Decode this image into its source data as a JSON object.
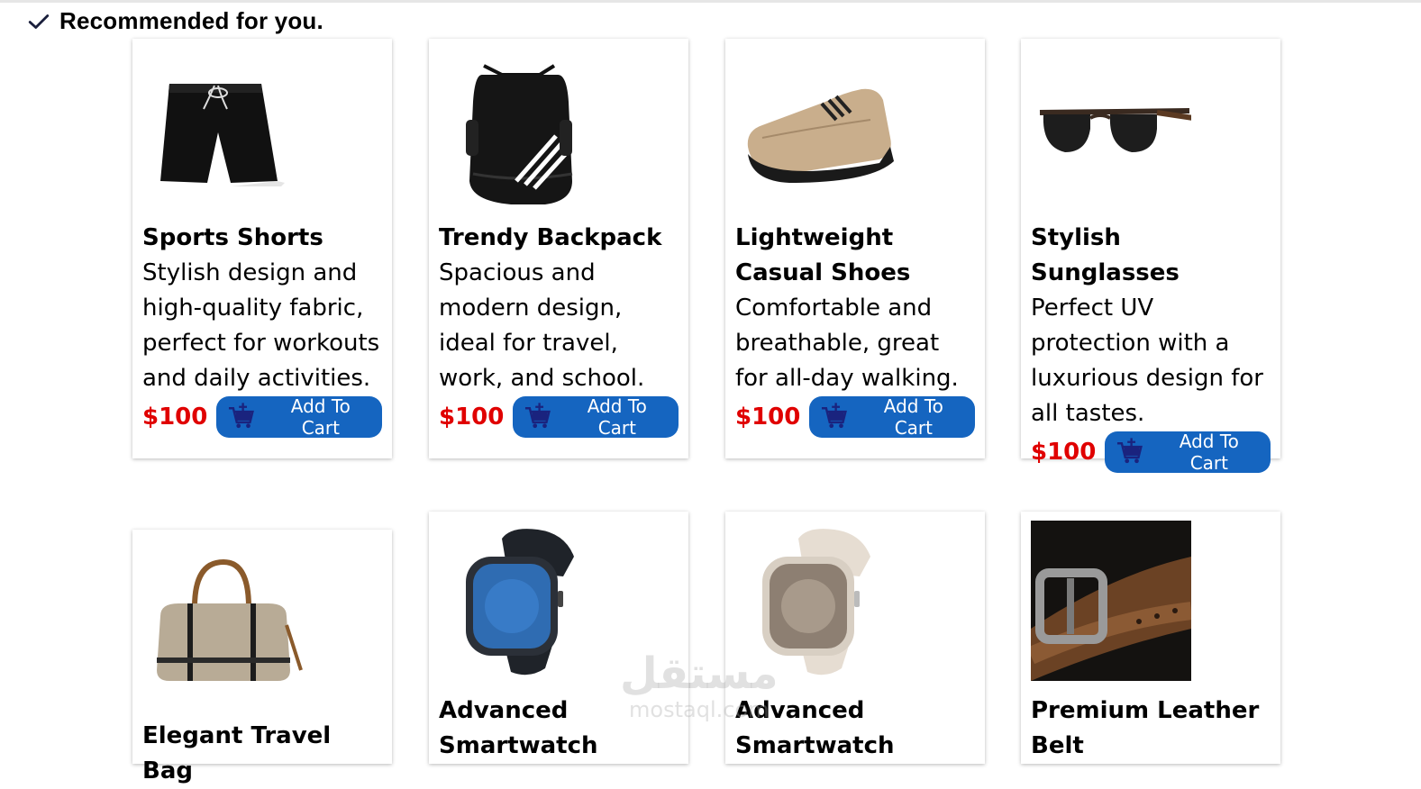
{
  "header": {
    "title": "Recommended for you."
  },
  "currency_price": "$100",
  "button_label": "Add To Cart",
  "products": [
    {
      "title": "Sports Shorts",
      "description": "Stylish design and high-quality fabric, perfect for workouts and daily activities.",
      "price": "$100",
      "button": "Add To Cart",
      "image": "shorts"
    },
    {
      "title": "Trendy Backpack",
      "description": "Spacious and modern design, ideal for travel, work, and school.",
      "price": "$100",
      "button": "Add To Cart",
      "image": "backpack"
    },
    {
      "title": "Lightweight Casual Shoes",
      "description": "Comfortable and breathable, great for all-day walking.",
      "price": "$100",
      "button": "Add To Cart",
      "image": "shoe"
    },
    {
      "title": "Stylish Sunglasses",
      "description": "Perfect UV protection with a luxurious design for all tastes.",
      "price": "$100",
      "button": "Add To Cart",
      "image": "sunglasses"
    },
    {
      "title": "Elegant Travel Bag",
      "description": "",
      "image": "travel-bag"
    },
    {
      "title": "Advanced Smartwatch",
      "description": "",
      "image": "smartwatch-black"
    },
    {
      "title": "Advanced Smartwatch",
      "description": "",
      "image": "smartwatch-starlight"
    },
    {
      "title": "Premium Leather Belt",
      "description": "",
      "image": "leather-belt"
    }
  ],
  "watermark": {
    "arabic": "مستقل",
    "latin": "mostaql.com"
  },
  "colors": {
    "accent": "#1565c0",
    "price": "#e00000"
  }
}
